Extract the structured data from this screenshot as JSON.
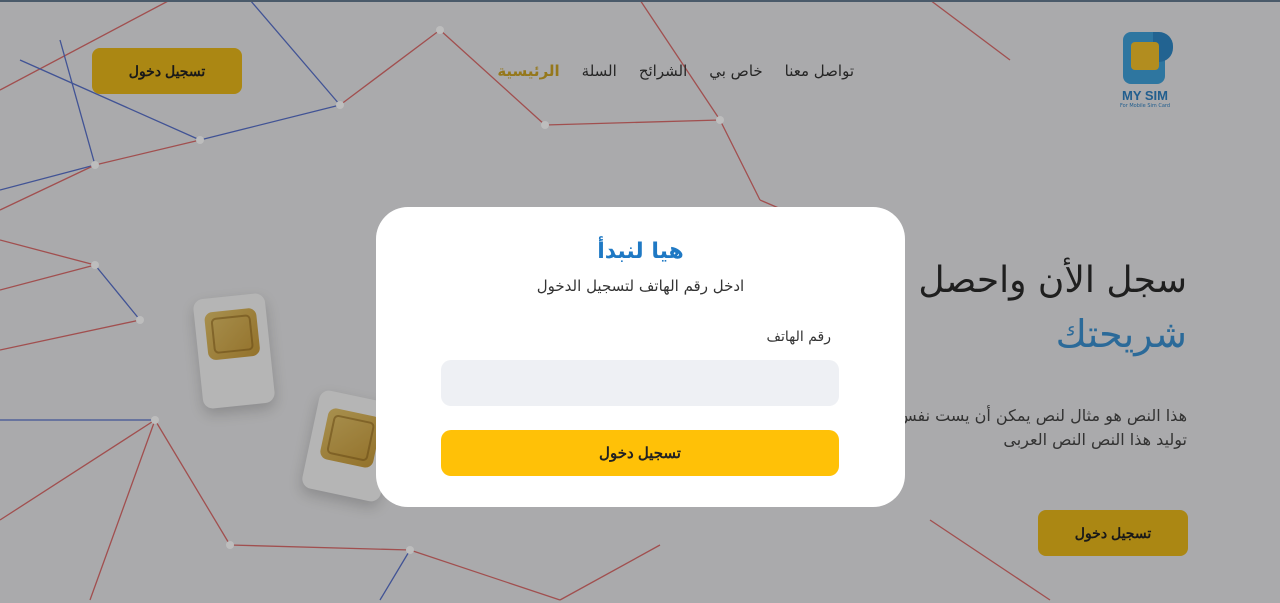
{
  "header": {
    "logo": {
      "name": "MY SIM",
      "tagline": "For Mobile Sim Card"
    },
    "nav": [
      {
        "label": "الرئيسية",
        "active": true
      },
      {
        "label": "السلة",
        "active": false
      },
      {
        "label": "الشرائح",
        "active": false
      },
      {
        "label": "خاص بي",
        "active": false
      },
      {
        "label": "تواصل معنا",
        "active": false
      }
    ],
    "login_button": "تسجيل دخول"
  },
  "hero": {
    "title": "سجل الأن واحصل",
    "subtitle": "شريحتك",
    "text": "هذا النص هو مثال لنص يمكن أن يست نفس المساحة، لقد تم توليد هذا النص النص العربى",
    "login_button": "تسجيل دخول"
  },
  "modal": {
    "title": "هيا لنبدأ",
    "subtitle": "ادخل رقم الهاتف لتسجيل الدخول",
    "phone_label": "رقم الهاتف",
    "phone_value": "",
    "submit": "تسجيل دخول"
  },
  "colors": {
    "accent": "#ffc107",
    "brand_blue": "#1f79c4",
    "gold": "#e7b71a"
  }
}
